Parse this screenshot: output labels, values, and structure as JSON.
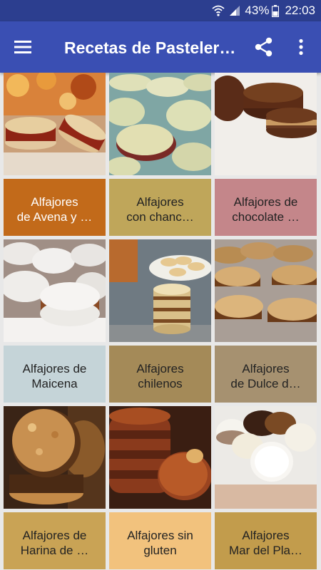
{
  "status": {
    "battery": "43%",
    "time": "22:03"
  },
  "app_bar": {
    "title": "Recetas de Pasteler…"
  },
  "colors": {
    "status_bar": "#2c3e8f",
    "app_bar": "#3a4fb3"
  },
  "recipes": [
    {
      "line1": "Alfajores",
      "line2": "de Avena y …",
      "caption_bg": "#c26a1a",
      "caption_color": "#ffffff",
      "image": "sandwich-cookies-autumn"
    },
    {
      "line1": "Alfajores",
      "line2": "con chanc…",
      "caption_bg": "#bfa65a",
      "caption_color": "#222222",
      "image": "pale-cookies-jam"
    },
    {
      "line1": "Alfajores de",
      "line2": "chocolate …",
      "caption_bg": "#c4868a",
      "caption_color": "#222222",
      "image": "chocolate-alfajor"
    },
    {
      "line1": "Alfajores de",
      "line2": "Maicena",
      "caption_bg": "#c5d4d8",
      "caption_color": "#222222",
      "image": "coconut-alfajores"
    },
    {
      "line1": "Alfajores",
      "line2": "chilenos",
      "caption_bg": "#a48a58",
      "caption_color": "#222222",
      "image": "stacked-alfajores"
    },
    {
      "line1": "Alfajores",
      "line2": "de Dulce d…",
      "caption_bg": "#a69170",
      "caption_color": "#222222",
      "image": "dulce-de-leche-alfajores"
    },
    {
      "line1": "Alfajores de",
      "line2": "Harina de …",
      "caption_bg": "#c9a355",
      "caption_color": "#222222",
      "image": "nut-alfajores"
    },
    {
      "line1": "Alfajores sin",
      "line2": "gluten",
      "caption_bg": "#f2c27d",
      "caption_color": "#222222",
      "image": "glazed-alfajores"
    },
    {
      "line1": "Alfajores",
      "line2": "Mar del Pla…",
      "caption_bg": "#c29c4c",
      "caption_color": "#222222",
      "image": "white-chocolate-alfajores"
    }
  ]
}
